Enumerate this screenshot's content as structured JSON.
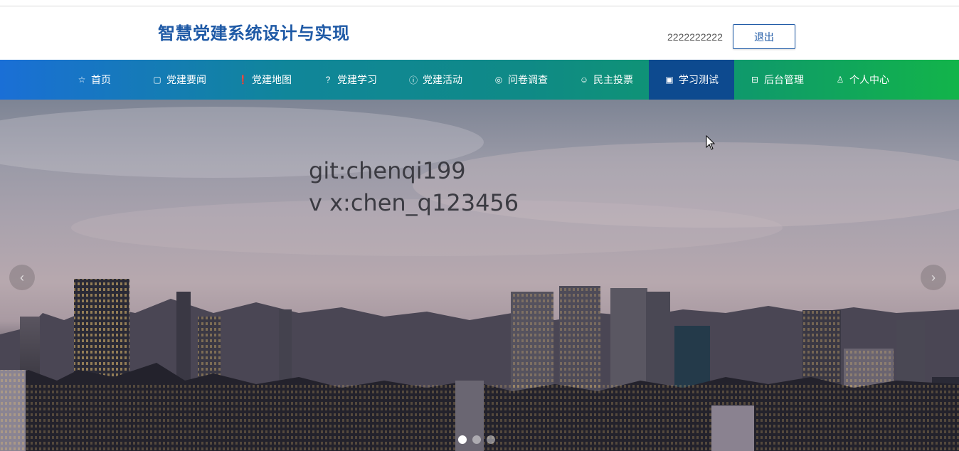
{
  "header": {
    "site_title": "智慧党建系统设计与实现",
    "username": "2222222222",
    "logout_label": "退出"
  },
  "nav": {
    "items": [
      {
        "label": "首页",
        "icon": "star-icon",
        "glyph": "☆"
      },
      {
        "label": "党建要闻",
        "icon": "bag-icon",
        "glyph": "▢"
      },
      {
        "label": "党建地图",
        "icon": "info-icon",
        "glyph": "❗"
      },
      {
        "label": "党建学习",
        "icon": "question-icon",
        "glyph": "?"
      },
      {
        "label": "党建活动",
        "icon": "info-circle-icon",
        "glyph": "ⓘ"
      },
      {
        "label": "问卷调查",
        "icon": "target-icon",
        "glyph": "◎"
      },
      {
        "label": "民主投票",
        "icon": "smile-icon",
        "glyph": "☺"
      },
      {
        "label": "学习测试",
        "icon": "camera-icon",
        "glyph": "▣",
        "active": true
      },
      {
        "label": "后台管理",
        "icon": "gift-icon",
        "glyph": "⊟"
      },
      {
        "label": "个人中心",
        "icon": "user-icon",
        "glyph": "♙"
      }
    ]
  },
  "banner": {
    "line1": "git:chenqi199",
    "line2": "v x:chen_q123456",
    "prev_glyph": "‹",
    "next_glyph": "›",
    "slide_count": 3,
    "active_slide": 1
  }
}
